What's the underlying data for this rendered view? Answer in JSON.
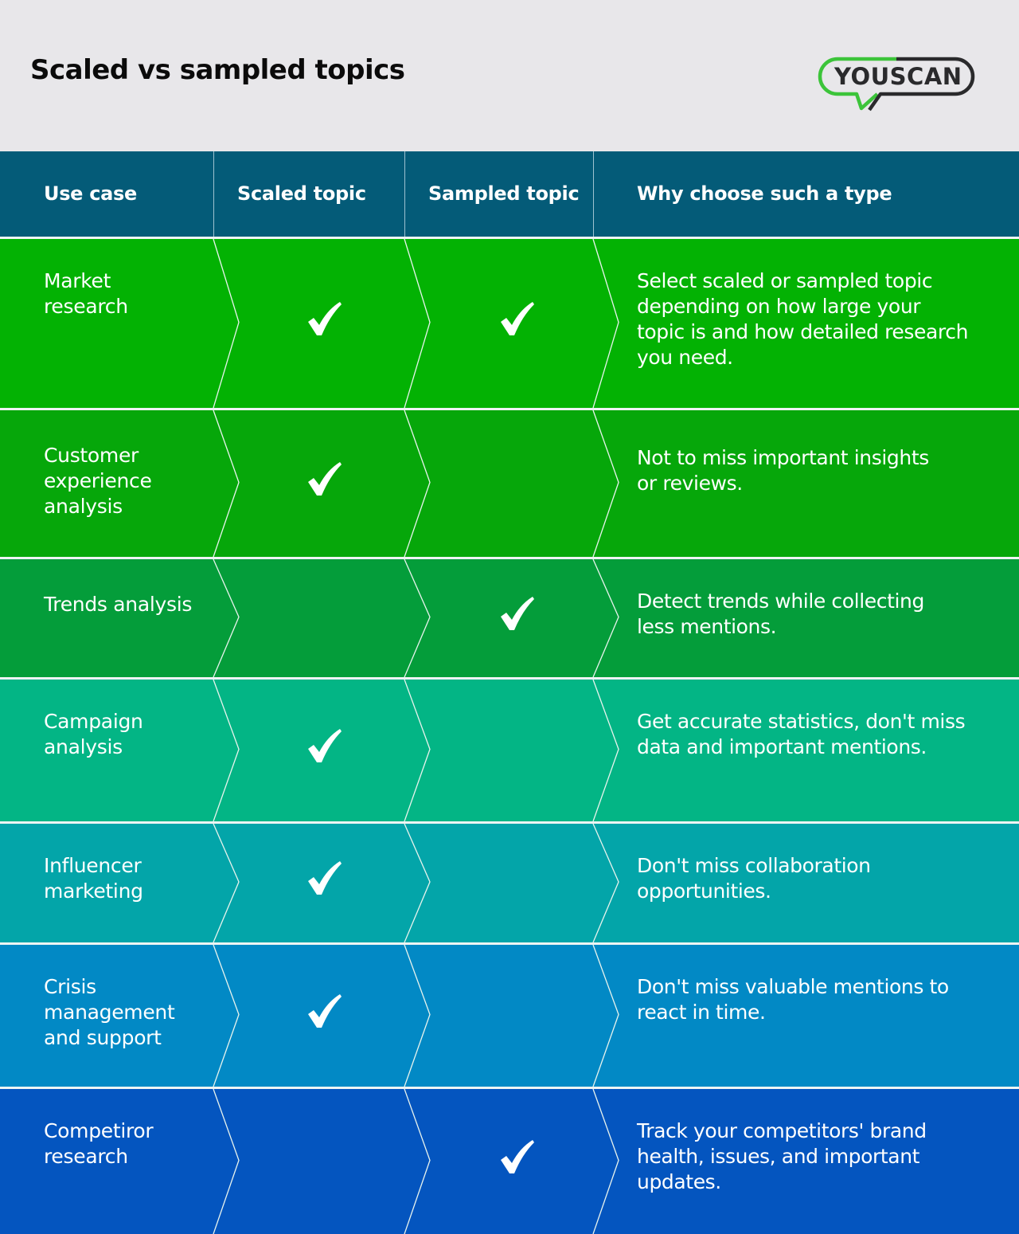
{
  "header": {
    "title": "Scaled vs sampled topics",
    "logo_text": "YOUSCAN",
    "logo_colors": {
      "green": "#3cc43a",
      "dark": "#2a2a2c"
    }
  },
  "table": {
    "columns": [
      "Use case",
      "Scaled topic",
      "Sampled topic",
      "Why choose such a type"
    ],
    "header_color": "#045b78",
    "rows": [
      {
        "use_case": [
          "Market",
          "research"
        ],
        "scaled": true,
        "sampled": true,
        "why": [
          "Select scaled or sampled topic",
          "depending on how large your",
          "topic is and how detailed research",
          "you need."
        ],
        "color": "#03b203"
      },
      {
        "use_case": [
          "Customer",
          "experience",
          "analysis"
        ],
        "scaled": true,
        "sampled": false,
        "why": [
          "Not to miss important insights",
          "or reviews."
        ],
        "color": "#06a70a"
      },
      {
        "use_case": [
          "Trends analysis"
        ],
        "scaled": false,
        "sampled": true,
        "why": [
          "Detect trends while collecting",
          "less mentions."
        ],
        "color": "#049d3a"
      },
      {
        "use_case": [
          "Campaign",
          "analysis"
        ],
        "scaled": true,
        "sampled": false,
        "why": [
          "Get accurate statistics, don't miss",
          "data and important mentions."
        ],
        "color": "#03b585"
      },
      {
        "use_case": [
          "Influencer",
          "marketing"
        ],
        "scaled": true,
        "sampled": false,
        "why": [
          "Don't miss collaboration",
          "opportunities."
        ],
        "color": "#03a5a9"
      },
      {
        "use_case": [
          "Crisis",
          "management",
          "and support"
        ],
        "scaled": true,
        "sampled": false,
        "why": [
          "Don't miss valuable mentions to",
          "react in time."
        ],
        "color": "#0289c5"
      },
      {
        "use_case": [
          "Competiror",
          "research"
        ],
        "scaled": false,
        "sampled": true,
        "why": [
          "Track your competitors' brand",
          "health, issues, and important",
          "updates."
        ],
        "color": "#0455bf"
      }
    ]
  },
  "icons": {
    "check": "check-icon"
  }
}
